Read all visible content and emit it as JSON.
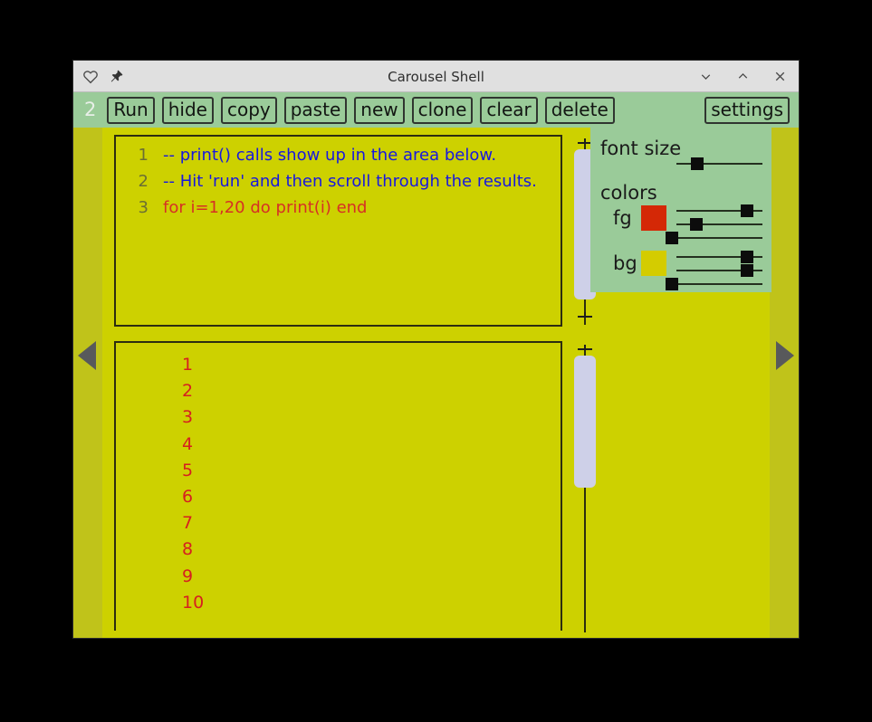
{
  "window": {
    "title": "Carousel Shell",
    "left_icons": [
      {
        "name": "heart-icon",
        "label": "favorite"
      },
      {
        "name": "pin-icon",
        "label": "pin window"
      }
    ],
    "controls": [
      {
        "name": "minimize-button",
        "glyph": "∨"
      },
      {
        "name": "maximize-button",
        "glyph": "∧"
      },
      {
        "name": "close-button",
        "glyph": "×"
      }
    ]
  },
  "toolbar": {
    "badge": "2",
    "buttons": [
      "Run",
      "hide",
      "copy",
      "paste",
      "new",
      "clone",
      "clear",
      "delete"
    ],
    "settings_label": "settings"
  },
  "editor": {
    "lines": [
      {
        "num": "1",
        "text": "-- print() calls show up in the area below.",
        "kind": "comment"
      },
      {
        "num": "2",
        "text": "-- Hit 'run' and then scroll through the results.",
        "kind": "comment"
      },
      {
        "num": "3",
        "text": "for i=1,20 do print(i) end",
        "kind": "code"
      }
    ]
  },
  "output": {
    "lines": [
      "1",
      "2",
      "3",
      "4",
      "5",
      "6",
      "7",
      "8",
      "9",
      "10"
    ]
  },
  "settings": {
    "font_size_label": "font size",
    "colors_label": "colors",
    "fg_label": "fg",
    "bg_label": "bg",
    "fg_color": "#d42806",
    "bg_color": "#d4cc00",
    "font_size_slider": 24,
    "fg_sliders": [
      82,
      23,
      2
    ],
    "bg_sliders": [
      82,
      82,
      2
    ]
  },
  "navigation": {
    "prev_label": "previous carousel page",
    "next_label": "next carousel page"
  },
  "colors": {
    "background": "#cdd100",
    "toolbar": "#9acb99",
    "titlebar": "#e0e0e0",
    "accent_red": "#d61f1f",
    "comment_blue": "#1717e0",
    "scrollbar_thumb": "#ced0e8",
    "side_strip": "#c0c31a"
  }
}
